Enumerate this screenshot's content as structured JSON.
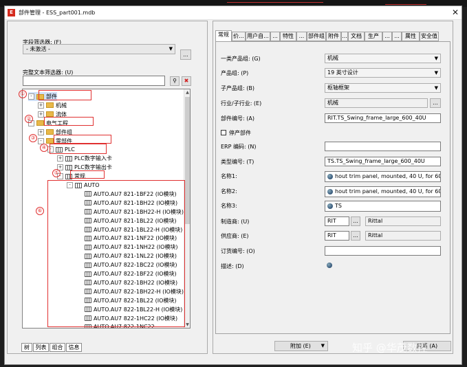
{
  "window": {
    "title": "部件管理 - ESS_part001.mdb",
    "app_icon": "E"
  },
  "left": {
    "field_filter_label": "字段筛选器: (F)",
    "field_filter_value": "- 未激活 -",
    "more_label": "...",
    "text_filter_label": "完整文本筛选器: (U)",
    "text_filter_value": "",
    "binoculars": "⚲",
    "clear": "✖",
    "tree": [
      {
        "label": "部件",
        "expander": "-",
        "icon": "folder"
      },
      {
        "label": "机械",
        "expander": "+",
        "icon": "folder"
      },
      {
        "label": "流体",
        "expander": "+",
        "icon": "folder"
      },
      {
        "label": "电气工程",
        "expander": "-",
        "icon": "folder"
      },
      {
        "label": "部件组",
        "expander": "+",
        "icon": "folder"
      },
      {
        "label": "零部件",
        "expander": "-",
        "icon": "folder"
      },
      {
        "label": "PLC",
        "expander": "-",
        "icon": "component"
      },
      {
        "label": "PLC数字输入卡",
        "expander": "+",
        "icon": "component"
      },
      {
        "label": "PLC数字输出卡",
        "expander": "+",
        "icon": "component"
      },
      {
        "label": "常规",
        "expander": "-",
        "icon": "component"
      },
      {
        "label": "AUTO",
        "expander": "-",
        "icon": "component"
      },
      {
        "label": "AUTO.AU7 821-1BF22 (IO模块)",
        "icon": "component"
      },
      {
        "label": "AUTO.AU7 821-1BH22 (IO模块)",
        "icon": "component"
      },
      {
        "label": "AUTO.AU7 821-1BH22-H (IO模块)",
        "icon": "component"
      },
      {
        "label": "AUTO.AU7 821-1BL22 (IO模块)",
        "icon": "component"
      },
      {
        "label": "AUTO.AU7 821-1BL22-H (IO模块)",
        "icon": "component"
      },
      {
        "label": "AUTO.AU7 821-1NF22 (IO模块)",
        "icon": "component"
      },
      {
        "label": "AUTO.AU7 821-1NH22 (IO模块)",
        "icon": "component"
      },
      {
        "label": "AUTO.AU7 821-1NL22 (IO模块)",
        "icon": "component"
      },
      {
        "label": "AUTO.AU7 822-1BC22 (IO模块)",
        "icon": "component"
      },
      {
        "label": "AUTO.AU7 822-1BF22 (IO模块)",
        "icon": "component"
      },
      {
        "label": "AUTO.AU7 822-1BH22 (IO模块)",
        "icon": "component"
      },
      {
        "label": "AUTO.AU7 822-1BH22-H (IO模块)",
        "icon": "component"
      },
      {
        "label": "AUTO.AU7 822-1BL22 (IO模块)",
        "icon": "component"
      },
      {
        "label": "AUTO.AU7 822-1BL22-H (IO模块)",
        "icon": "component"
      },
      {
        "label": "AUTO.AU7 822-1HC22 (IO模块)",
        "icon": "component"
      },
      {
        "label": "AUTO.AU7 822-1NC22",
        "icon": "component"
      }
    ],
    "callouts": [
      "①",
      "②",
      "③",
      "④",
      "⑤",
      "⑥"
    ],
    "bottom_tabs": [
      "树",
      "列表",
      "组合",
      "信息"
    ]
  },
  "right": {
    "tabs": [
      "常规",
      "价...",
      "用户自...",
      "...",
      "特性",
      "...",
      "部件组",
      "附件",
      "...",
      "文档",
      "生产",
      "...",
      "...",
      "属性",
      "安全值"
    ],
    "fields": [
      {
        "label": "一类产品组: (G)",
        "value": "机械",
        "kind": "combo"
      },
      {
        "label": "产品组: (P)",
        "value": "19 英寸设计",
        "kind": "combo"
      },
      {
        "label": "子产品组: (B)",
        "value": "枢轴框架",
        "kind": "combo"
      },
      {
        "label": "行业/子行业: (E)",
        "value": "机械",
        "kind": "readonly"
      },
      {
        "label": "部件编号: (A)",
        "value": "RIT.TS_Swing_frame_large_600_40U",
        "kind": "text"
      },
      {
        "label": "停产部件",
        "value": "",
        "kind": "check"
      },
      {
        "label": "ERP 编码: (N)",
        "value": "",
        "kind": "text"
      },
      {
        "label": "类型编号: (T)",
        "value": "TS.TS_Swing_frame_large_600_40U",
        "kind": "text"
      },
      {
        "label": "名称1:",
        "value": "hout trim panel, mounted, 40 U, for 600 r",
        "kind": "ml"
      },
      {
        "label": "名称2:",
        "value": "hout trim panel, mounted, 40 U, for 600 r",
        "kind": "ml"
      },
      {
        "label": "名称3:",
        "value": "TS",
        "kind": "ml"
      },
      {
        "label": "制造商: (U)",
        "value": "RIT",
        "kind": "vendor",
        "name": "Rittal"
      },
      {
        "label": "供应商: (E)",
        "value": "RIT",
        "kind": "vendor",
        "name": "Rittal"
      },
      {
        "label": "订货编号: (O)",
        "value": "",
        "kind": "text"
      },
      {
        "label": "描述: (D)",
        "value": "",
        "kind": "desc"
      }
    ],
    "add_button": "附加 (E)",
    "apply_button": "应用 (A)",
    "dropdown_arrow": "▼",
    "more_label": "..."
  },
  "watermark": "知乎 @华茂数控"
}
